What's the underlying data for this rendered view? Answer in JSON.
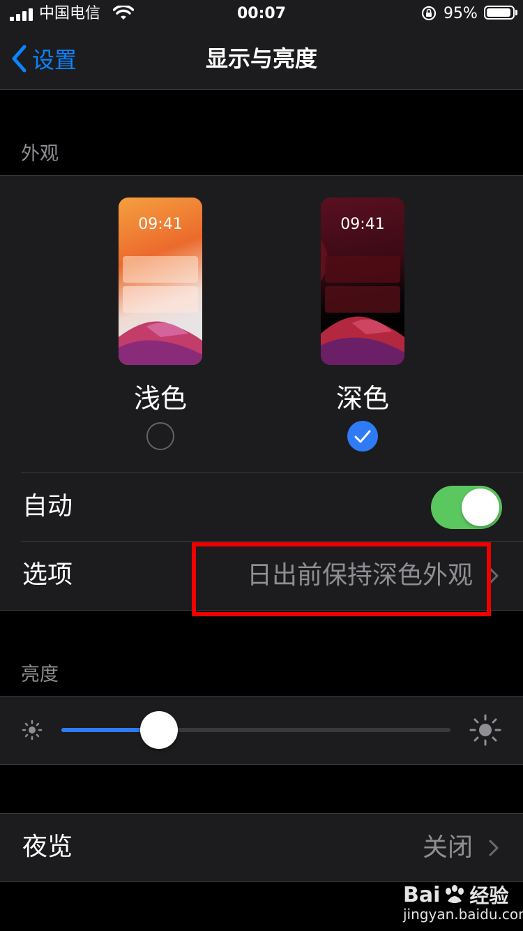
{
  "status_bar": {
    "carrier": "中国电信",
    "time": "00:07",
    "battery_percent": "95%",
    "battery_level": 0.95
  },
  "nav": {
    "back_label": "设置",
    "title": "显示与亮度"
  },
  "appearance": {
    "section_title": "外观",
    "light": {
      "preview_time": "09:41",
      "label": "浅色",
      "selected": false
    },
    "dark": {
      "preview_time": "09:41",
      "label": "深色",
      "selected": true
    }
  },
  "automatic": {
    "label": "自动",
    "on": true
  },
  "options": {
    "label": "选项",
    "value": "日出前保持深色外观"
  },
  "brightness": {
    "section_title": "亮度",
    "level": 0.25
  },
  "night_shift": {
    "label": "夜览",
    "value": "关闭"
  },
  "watermark": {
    "brand": "Bai",
    "brand2": "经验",
    "url": "jingyan.baidu.com"
  },
  "colors": {
    "accent": "#0a84ff",
    "toggle_on": "#5ac85e",
    "highlight": "#ee0000"
  }
}
